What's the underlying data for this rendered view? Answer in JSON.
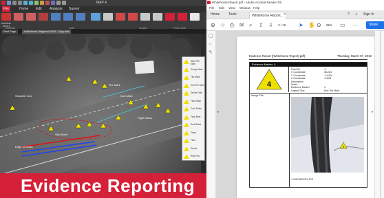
{
  "left_app": {
    "title": "MAP 4",
    "menu": [
      "File",
      "Home",
      "Edit",
      "Analysis",
      "Survey"
    ],
    "ribbon_buttons": [
      "AutoMap Library",
      "Recognize ...",
      "Recognize ...",
      "Reference Points",
      "Report Points",
      "Line Options",
      "Report Line",
      "Evidence Measurement",
      "Annotation",
      "Move Leader",
      "Curved Leader",
      "Leader Shape",
      "Edit Images",
      "Import Image",
      "Import PDF",
      "Import Line"
    ],
    "ribbon_groups": [
      "AutoMap",
      "Tools",
      "Images",
      "Point Cloud"
    ],
    "doc_tabs": [
      "Start Page",
      "Whitehorse Diagrams 2019 - Copy.mfd"
    ],
    "scene_labels": [
      {
        "text": "Tire Mark"
      },
      {
        "text": "Skid Mark"
      },
      {
        "text": "Curb Mark"
      },
      {
        "text": "Shoulder Line"
      },
      {
        "text": "Edge of Grass"
      },
      {
        "text": "Right Marks"
      }
    ],
    "evidence_panel": [
      {
        "num": "1",
        "label": "Start Tire Mark"
      },
      {
        "num": "2",
        "label": "Gouge Mark"
      },
      {
        "num": "3",
        "label": "Tire Mark"
      },
      {
        "num": "4",
        "label": "End Tire Mark"
      },
      {
        "num": "5",
        "label": "Debris Field"
      },
      {
        "num": "6",
        "label": "Fluid Stain"
      },
      {
        "num": "7",
        "label": "Curb Strike"
      },
      {
        "num": "8",
        "label": "Final Rest"
      },
      {
        "num": "9",
        "label": "Scuff Mark"
      },
      {
        "num": "10",
        "label": "Glass"
      },
      {
        "num": "11",
        "label": "Fluid"
      },
      {
        "num": "12",
        "label": "Debris"
      },
      {
        "num": "13",
        "label": "Rest Pos"
      }
    ],
    "banner_text": "Evidence Reporting"
  },
  "right_app": {
    "window_title": "Whitehorse Report.pdf - Adobe Acrobat Reader DC",
    "menu": [
      "File",
      "Edit",
      "View",
      "Window",
      "Help"
    ],
    "tabs": [
      "Home",
      "Tools",
      "Whitehorse Report..."
    ],
    "sign_in": "Sign In",
    "page_number": "3",
    "page_total": "/ 10",
    "zoom": "95%",
    "share_label": "Share",
    "pdf": {
      "report_title": "Evidence Report ([Whitehorse Report].pdf)",
      "report_date": "Thursday, March 07, 2019",
      "marker_header": "Evidence Marker: 4",
      "marker_number": "4",
      "fields": [
        {
          "name": "Point ID",
          "value": "4"
        },
        {
          "name": "X Coordinate",
          "value": "36.223"
        },
        {
          "name": "Y Coordinate",
          "value": "-14.004"
        },
        {
          "name": "Z Coordinate",
          "value": "-0.824"
        },
        {
          "name": "Description",
          "value": ""
        },
        {
          "name": "Notes",
          "value": ""
        },
        {
          "name": "Evidence Marker",
          "value": "4"
        },
        {
          "name": "Legend Text",
          "value": "End Tire Mark"
        }
      ],
      "image_file_label": "Image File",
      "image_caption": "1-SUP0DSCF0.JPG",
      "photo_marker": "4"
    }
  },
  "colors": {
    "banner": "#d42039",
    "marker_yellow": "#f0e000",
    "line_blue": "#2244ee",
    "lasso_red": "#dd1111",
    "share_blue": "#1a73e8"
  }
}
